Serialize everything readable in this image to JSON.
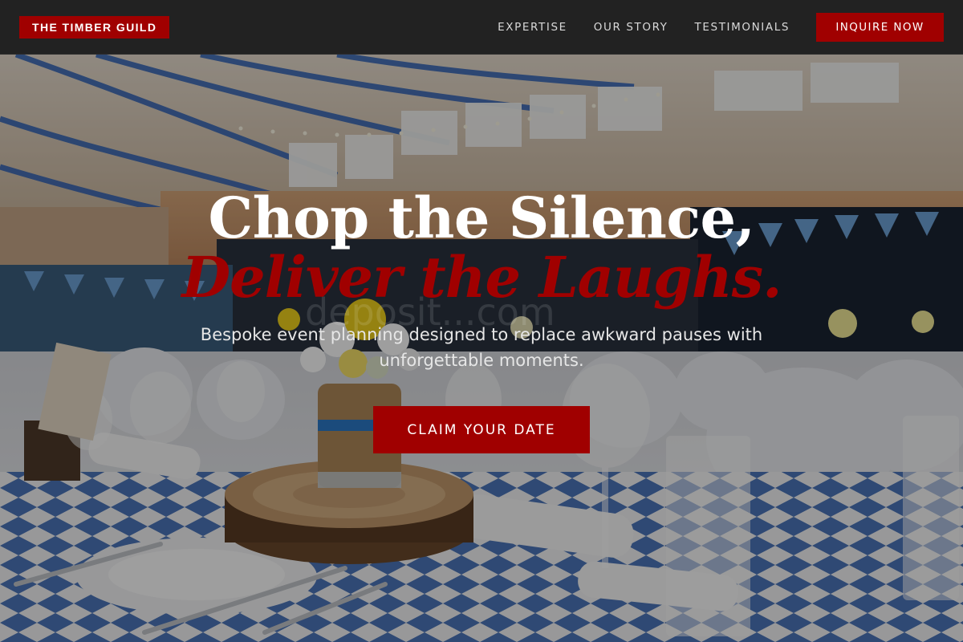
{
  "nav": {
    "brand": "THE TIMBER GUILD",
    "links": [
      "EXPERTISE",
      "OUR STORY",
      "TESTIMONIALS"
    ],
    "cta": "INQUIRE NOW"
  },
  "hero": {
    "headline": "Chop the Silence,",
    "headline_accent": "Deliver the Laughs.",
    "subheadline": "Bespoke event planning designed to replace awkward pauses with unforgettable moments.",
    "cta": "CLAIM YOUR DATE",
    "watermark": "deposit...com"
  },
  "colors": {
    "accent": "#a00000",
    "nav_background": "#222222",
    "text_light": "#ffffff"
  }
}
